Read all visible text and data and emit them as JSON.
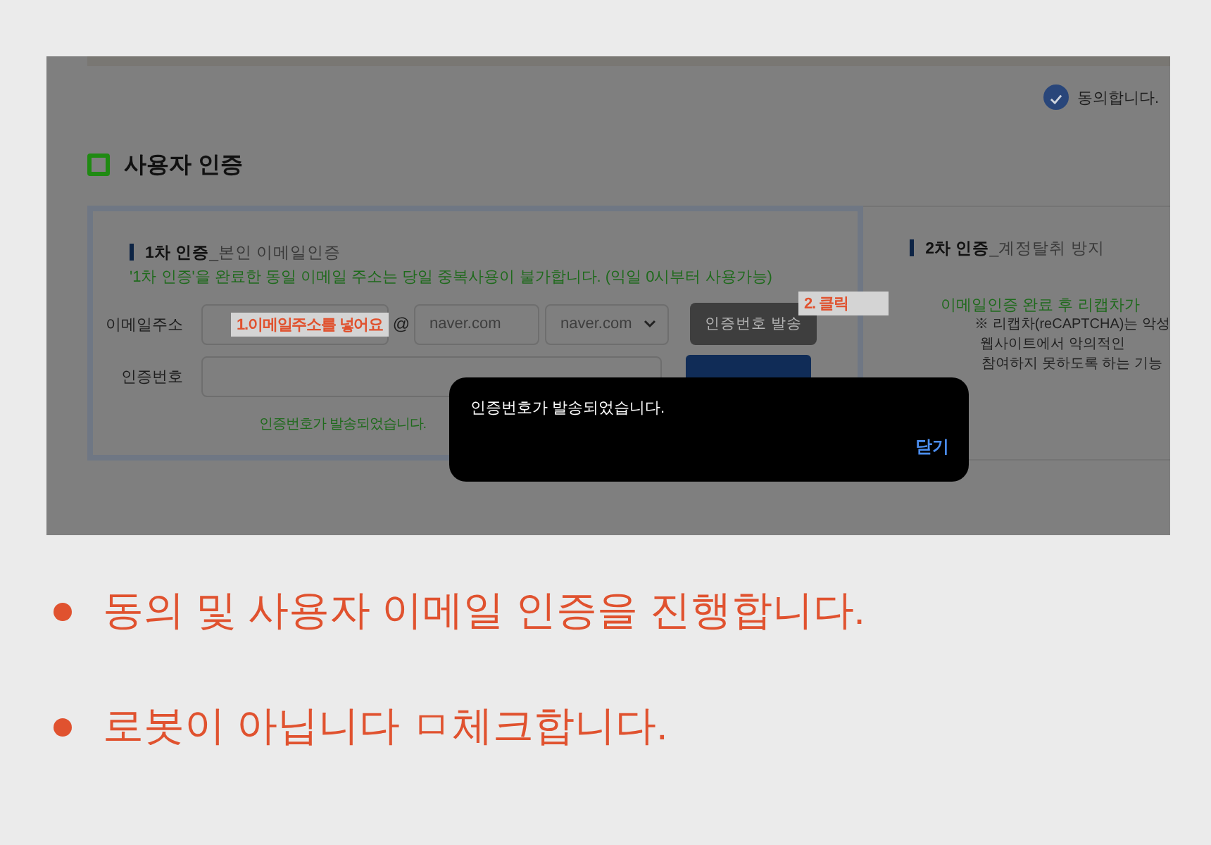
{
  "screenshot": {
    "agreement": {
      "label": "동의합니다.",
      "checked": true
    },
    "section_title": "사용자 인증",
    "first_auth": {
      "heading": "1차 인증",
      "subheading": "_본인 이메일인증",
      "notice": "'1차 인증'을 완료한 동일 이메일 주소는 당일 중복사용이 불가합니다. (익일 0시부터 사용가능)",
      "email_label": "이메일주소",
      "at": "@",
      "domain_value": "naver.com",
      "domain_select": "naver.com",
      "send_button": "인증번호 발송",
      "code_label": "인증번호",
      "status": "인증번호가 발송되었습니다."
    },
    "second_auth": {
      "heading": "2차 인증",
      "subheading": "_계정탈취 방지",
      "notice": "이메일인증 완료 후 리캡차가",
      "lines": [
        "※ 리캡차(reCAPTCHA)는 악성",
        "웹사이트에서 악의적인",
        "참여하지 못하도록 하는 기능"
      ]
    },
    "annotations": [
      {
        "text": "1.이메일주소를 넣어요"
      },
      {
        "text": "2. 클릭"
      }
    ],
    "dialog": {
      "message": "인증번호가 발송되었습니다.",
      "close": "닫기"
    }
  },
  "steps": [
    "동의 및 사용자 이메일 인증을 진행합니다.",
    "로봇이 아닙니다 ㅁ체크합니다."
  ]
}
